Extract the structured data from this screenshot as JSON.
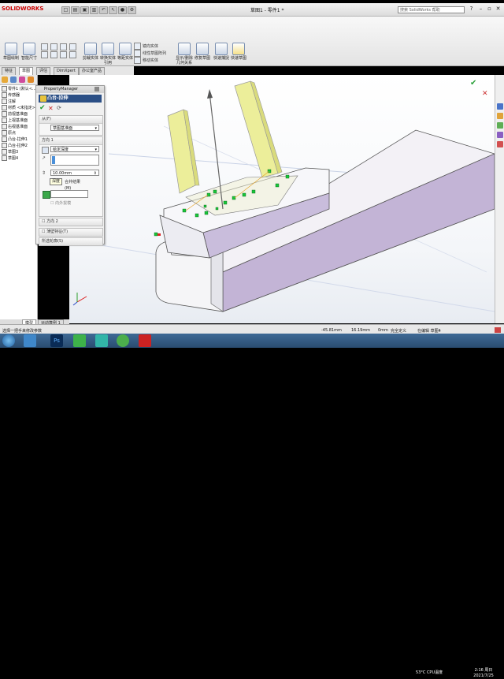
{
  "app": {
    "logo_text": "SOLIDWORKS",
    "document_title": "草图1 - 零件1 *",
    "search_placeholder": "搜索 SolidWorks 帮助"
  },
  "ribbon": {
    "buttons": [
      {
        "label": "草图绘制",
        "icon": "sketch-icon"
      },
      {
        "label": "智能尺寸",
        "icon": "smart-dimension-icon"
      },
      {
        "label": "剪裁实体",
        "icon": "trim-icon"
      },
      {
        "label": "转换实体引用",
        "icon": "convert-entities-icon"
      },
      {
        "label": "等距实体",
        "icon": "offset-entities-icon"
      },
      {
        "label": "显示/删除几何关系",
        "icon": "relations-icon"
      },
      {
        "label": "修复草图",
        "icon": "repair-sketch-icon"
      },
      {
        "label": "快速捕捉",
        "icon": "quick-snaps-icon"
      },
      {
        "label": "快速草图",
        "icon": "rapid-sketch-icon"
      }
    ],
    "small_items": [
      "镜向实体",
      "线性草图阵列",
      "移动实体"
    ]
  },
  "tabs": [
    "特征",
    "草图",
    "评估",
    "DimXpert",
    "办公室产品"
  ],
  "active_tab": "草图",
  "feature_tree": {
    "items": [
      "零件1 (默认<...",
      "传感器",
      "注解",
      "材质 <未指定>",
      "前视基准面",
      "上视基准面",
      "右视基准面",
      "原点",
      "凸台-拉伸1",
      "凸台-拉伸2",
      "草图3",
      "草图4"
    ]
  },
  "property_manager": {
    "header": "PropertyManager",
    "title": "凸台-拉伸",
    "from_group": {
      "label": "从(F)",
      "value": "草图基准面"
    },
    "direction1": {
      "label": "方向 1",
      "end_condition": "给定深度",
      "depth": "10.00mm",
      "tooltip": "深度",
      "merge_label": "合并结果(M)",
      "draft_label": "向外拔模"
    },
    "direction2_label": "方向 2",
    "thin_feature_label": "薄壁特征(T)",
    "contours_label": "所选轮廓(S)"
  },
  "status_bar": {
    "hint": "选择一把手来修改参数",
    "x": "-45.81mm",
    "y": "16.19mm",
    "z": "0mm",
    "state": "完全定义",
    "editing": "在编辑 草图4"
  },
  "bottom_tabs": [
    "模型",
    "运动算例 1"
  ],
  "taskbar": {
    "apps": [
      "start",
      "explorer",
      "photoshop",
      "foxit",
      "files",
      "wechat",
      "solidworks"
    ],
    "tray": "53°C CPU温度",
    "time": "2:16 周日",
    "date": "2021/7/25"
  },
  "colors": {
    "accent": "#2b4f86",
    "extrude_yellow": "#ecee9a",
    "part_purple": "#c8bcd6",
    "handle_green": "#17c63a"
  }
}
